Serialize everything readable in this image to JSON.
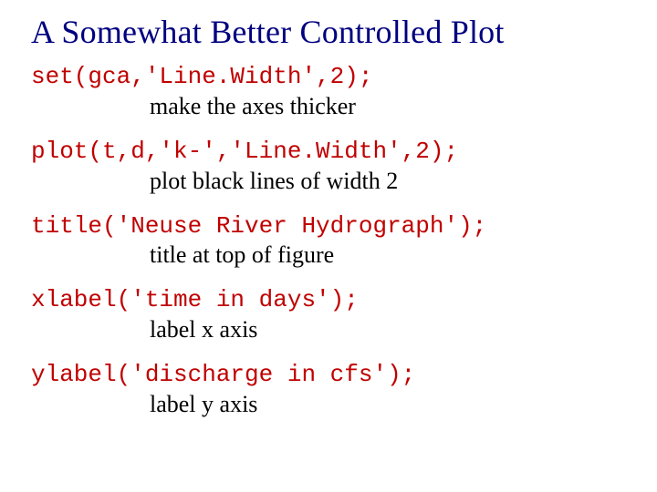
{
  "title": "A Somewhat Better Controlled Plot",
  "items": [
    {
      "code": "set(gca,'Line.Width',2);",
      "caption": "make the axes thicker"
    },
    {
      "code": "plot(t,d,'k-','Line.Width',2);",
      "caption": "plot black lines of width 2"
    },
    {
      "code": "title('Neuse River Hydrograph');",
      "caption": "title at top of figure"
    },
    {
      "code": "xlabel('time in days');",
      "caption": "label x axis"
    },
    {
      "code": "ylabel('discharge in cfs');",
      "caption": "label y axis"
    }
  ]
}
